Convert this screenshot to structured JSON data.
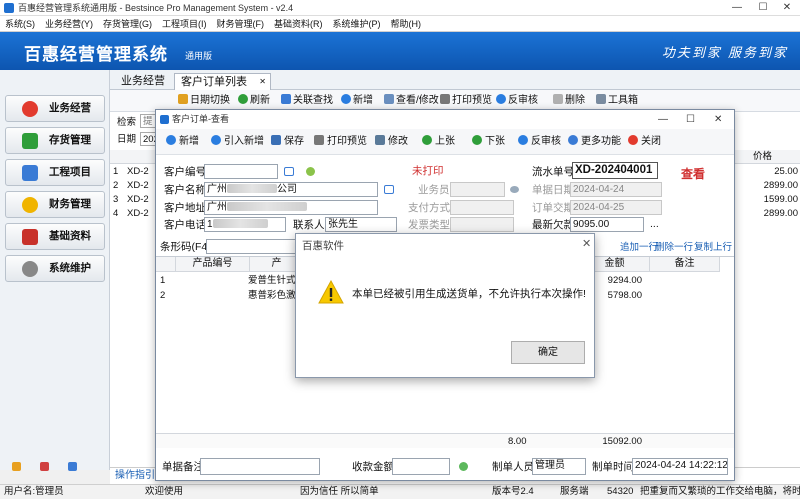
{
  "window": {
    "title": "百惠经营管理系统通用版 - Bestsince Pro Management System - v2.4",
    "min": "—",
    "max": "☐",
    "close": "✕"
  },
  "menu": [
    "系统(S)",
    "业务经营(Y)",
    "存货管理(G)",
    "工程项目(I)",
    "财务管理(F)",
    "基础资料(R)",
    "系统维护(P)",
    "帮助(H)"
  ],
  "banner": {
    "title": "百惠经营管理系统",
    "edition": "通用版",
    "slogan": "功夫到家  服务到家"
  },
  "sidebar": [
    {
      "label": "业务经营",
      "icon": "business-icon",
      "color": "#e23b2e"
    },
    {
      "label": "存货管理",
      "icon": "inventory-icon",
      "color": "#2f9e3a"
    },
    {
      "label": "工程项目",
      "icon": "project-icon",
      "color": "#3a7bd5"
    },
    {
      "label": "财务管理",
      "icon": "finance-icon",
      "color": "#f0b400"
    },
    {
      "label": "基础资料",
      "icon": "base-data-icon",
      "color": "#c8312a"
    },
    {
      "label": "系统维护",
      "icon": "gear-icon",
      "color": "#888888"
    }
  ],
  "tabs": [
    "业务经营",
    "客户订单列表"
  ],
  "tab_close": "✕",
  "toolbar": [
    "日期切换",
    "刷新",
    "关联查找",
    "新增",
    "查看/修改",
    "打印预览",
    "反审核",
    "删除",
    "工具箱"
  ],
  "bg": {
    "search_label": "检索",
    "search_value": "提",
    "date_label": "日期",
    "date_value": "2024",
    "price_header": "价格",
    "rows": [
      {
        "n": "1",
        "code": "XD-2",
        "price": "25.00"
      },
      {
        "n": "2",
        "code": "XD-2",
        "price": "2899.00"
      },
      {
        "n": "3",
        "code": "XD-2",
        "price": "1599.00"
      },
      {
        "n": "4",
        "code": "XD-2",
        "price": "2899.00"
      }
    ]
  },
  "bottom_hint": "操作指引：",
  "status": {
    "user": "用户名:管理员",
    "welcome": "欢迎使用",
    "motto": "因为信任 所以简单",
    "version": "版本号2.4",
    "service": "服务端",
    "port": "54320",
    "ticker": "把重复而又繁琐的工作交给电脑，将时间"
  },
  "dialog": {
    "title": "客户订单-查看",
    "tools": [
      "新增",
      "引入新增",
      "保存",
      "打印预览",
      "修改",
      "上张",
      "下张",
      "反审核",
      "更多功能",
      "关闭"
    ],
    "print_status": "未打印",
    "view_status": "查看",
    "labels": {
      "cust_code": "客户编号",
      "cust_name": "客户名称",
      "cust_addr": "客户地址",
      "cust_phone": "客户电话",
      "contact": "联系人",
      "salesman": "业务员",
      "pay": "支付方式",
      "invoice": "发票类型",
      "serial": "流水单号",
      "bill_date": "单据日期",
      "delivery": "订单交期",
      "debt": "最新欠款",
      "barcode": "条形码(F4)",
      "remark": "单据备注",
      "received": "收款金额",
      "maker": "制单人员",
      "make_time": "制单时间"
    },
    "values": {
      "cust_name": "广州",
      "cust_name_tail": "公司",
      "cust_addr": "广州",
      "cust_phone": "1",
      "contact": "张先生",
      "serial": "XD-202404001",
      "bill_date": "2024-04-24",
      "delivery": "2024-04-25",
      "debt": "9095.00",
      "maker": "管理员",
      "make_time": "2024-04-24 14:22:12"
    },
    "row_links": [
      "插入一行",
      "追加一行",
      "删除一行",
      "复制上行"
    ],
    "more": "...",
    "grid": {
      "headers": [
        "产品编号",
        "产",
        "金额",
        "备注"
      ],
      "rows": [
        {
          "n": "1",
          "product": "爱普生针式打",
          "amount": "9294.00"
        },
        {
          "n": "2",
          "product": "惠普彩色激光",
          "amount": "5798.00"
        }
      ],
      "total_qty": "8.00",
      "total_amount": "15092.00"
    }
  },
  "message": {
    "title": "百惠软件",
    "text": "本单已经被引用生成送货单，不允许执行本次操作!",
    "ok": "确定",
    "close": "✕"
  }
}
